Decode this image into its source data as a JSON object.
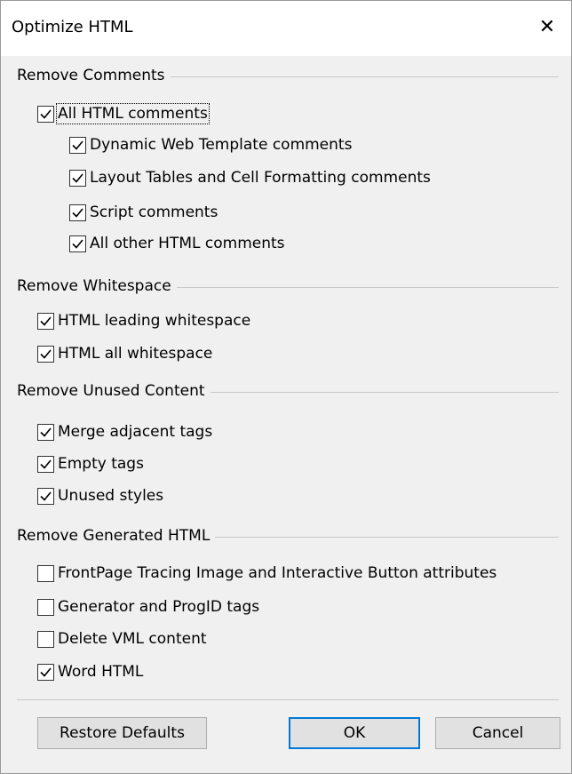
{
  "window": {
    "title": "Optimize HTML",
    "close_glyph": "✕"
  },
  "groups": [
    {
      "label": "Remove Comments",
      "items": [
        {
          "label": "All HTML comments",
          "checked": true
        },
        {
          "label": "Dynamic Web Template comments",
          "checked": true
        },
        {
          "label": "Layout Tables and Cell Formatting comments",
          "checked": true
        },
        {
          "label": "Script comments",
          "checked": true
        },
        {
          "label": "All other HTML comments",
          "checked": true
        }
      ]
    },
    {
      "label": "Remove Whitespace",
      "items": [
        {
          "label": "HTML leading whitespace",
          "checked": true
        },
        {
          "label": "HTML all whitespace",
          "checked": true
        }
      ]
    },
    {
      "label": "Remove Unused Content",
      "items": [
        {
          "label": "Merge adjacent tags",
          "checked": true
        },
        {
          "label": "Empty tags",
          "checked": true
        },
        {
          "label": "Unused styles",
          "checked": true
        }
      ]
    },
    {
      "label": "Remove Generated HTML",
      "items": [
        {
          "label": "FrontPage Tracing Image and Interactive Button attributes",
          "checked": false
        },
        {
          "label": "Generator and ProgID tags",
          "checked": false
        },
        {
          "label": "Delete VML content",
          "checked": false
        },
        {
          "label": "Word HTML",
          "checked": true
        }
      ]
    }
  ],
  "buttons": {
    "restore": "Restore Defaults",
    "ok": "OK",
    "cancel": "Cancel"
  }
}
